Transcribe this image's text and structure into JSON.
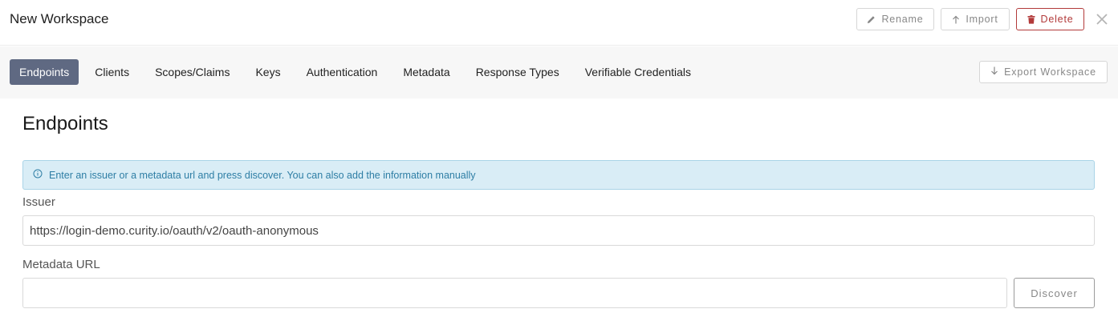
{
  "header": {
    "workspace_title": "New Workspace",
    "rename_label": "Rename",
    "import_label": "Import",
    "delete_label": "Delete"
  },
  "tabs": [
    {
      "label": "Endpoints",
      "active": true
    },
    {
      "label": "Clients",
      "active": false
    },
    {
      "label": "Scopes/Claims",
      "active": false
    },
    {
      "label": "Keys",
      "active": false
    },
    {
      "label": "Authentication",
      "active": false
    },
    {
      "label": "Metadata",
      "active": false
    },
    {
      "label": "Response Types",
      "active": false
    },
    {
      "label": "Verifiable Credentials",
      "active": false
    }
  ],
  "export_label": "Export Workspace",
  "main": {
    "title": "Endpoints",
    "info_message": "Enter an issuer or a metadata url and press discover. You can also add the information manually",
    "issuer_label": "Issuer",
    "issuer_value": "https://login-demo.curity.io/oauth/v2/oauth-anonymous",
    "metadata_label": "Metadata URL",
    "metadata_value": "",
    "discover_label": "Discover"
  },
  "colors": {
    "active_tab": "#5f6982",
    "delete_accent": "#b23a3a",
    "info_bg": "#d9edf6",
    "info_text": "#2e7ea5"
  },
  "icons": {
    "rename": "pencil-icon",
    "import": "arrow-up-icon",
    "delete": "trash-icon",
    "close": "close-icon",
    "export": "arrow-down-icon",
    "info": "info-circle-icon"
  }
}
